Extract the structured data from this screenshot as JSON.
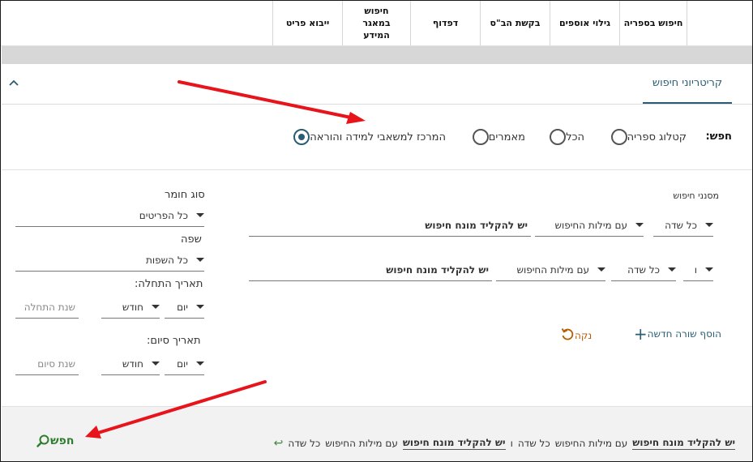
{
  "nav": {
    "items": [
      {
        "label": "חיפוש בספריה"
      },
      {
        "label": "גילוי אוספים"
      },
      {
        "label": "בקשת הב\"ס"
      },
      {
        "label": "דפדוף"
      },
      {
        "label": "חיפוש במאגר המידע"
      },
      {
        "label": "ייבוא פריט"
      }
    ]
  },
  "criteria": {
    "tab_label": "קריטריוני חיפוש"
  },
  "scope": {
    "label": "חפש:",
    "options": [
      {
        "label": "קטלוג ספריה",
        "checked": false
      },
      {
        "label": "הכל",
        "checked": false
      },
      {
        "label": "מאמרים",
        "checked": false
      },
      {
        "label": "המרכז למשאבי למידה והוראה",
        "checked": true
      }
    ]
  },
  "filters": {
    "label": "מסנני חיפוש",
    "rows": [
      {
        "field": "כל שדה",
        "operator": "עם מילות החיפוש",
        "term": "יש להקליד מונח חיפוש"
      },
      {
        "bool": "ו",
        "field": "כל שדה",
        "operator": "עם מילות החיפוש",
        "term": "יש להקליד מונח חיפוש"
      }
    ],
    "add_row": "הוסף שורה חדשה",
    "clear": "נקה"
  },
  "sidebar": {
    "material_label": "סוג חומר",
    "material_value": "כל הפריטים",
    "language_label": "שפה",
    "language_value": "כל השפות",
    "start_label": "תאריך התחלה:",
    "end_label": "תאריך סיום:",
    "day": "יום",
    "month": "חודש",
    "start_year": "שנת התחלה",
    "end_year": "שנת סיום"
  },
  "summary": {
    "field1": "כל שדה",
    "op1": "עם מילות החיפוש",
    "term1": "יש להקליד מונח חיפוש",
    "bool": "ו",
    "field2": "כל שדה",
    "op2": "עם מילות החיפוש",
    "term2": "יש להקליד מונח חיפוש",
    "search_label": "חפש"
  },
  "colors": {
    "accent": "#2a5d73",
    "search_green": "#2e7d2e",
    "clear_orange": "#b35c00",
    "annotation_red": "#e8141b"
  }
}
